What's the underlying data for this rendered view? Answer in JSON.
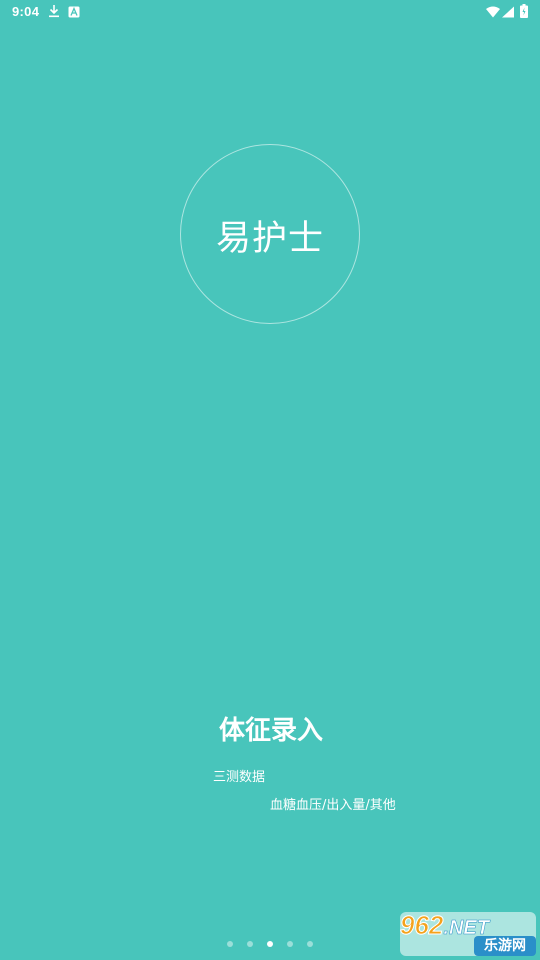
{
  "status_bar": {
    "time": "9:04",
    "icons": [
      "download-icon",
      "a-notification-icon",
      "wifi-icon",
      "signal-icon",
      "battery-icon"
    ]
  },
  "app": {
    "logo_text": "易护士"
  },
  "feature": {
    "title": "体征录入",
    "line1": "三测数据",
    "line2": "血糖血压/出入量/其他"
  },
  "pager": {
    "count": 5,
    "active_index": 2
  },
  "watermark": {
    "number": "962",
    "suffix": ".NET",
    "sub": "乐游网"
  },
  "colors": {
    "background": "#48c5bb",
    "text": "#ffffff"
  }
}
